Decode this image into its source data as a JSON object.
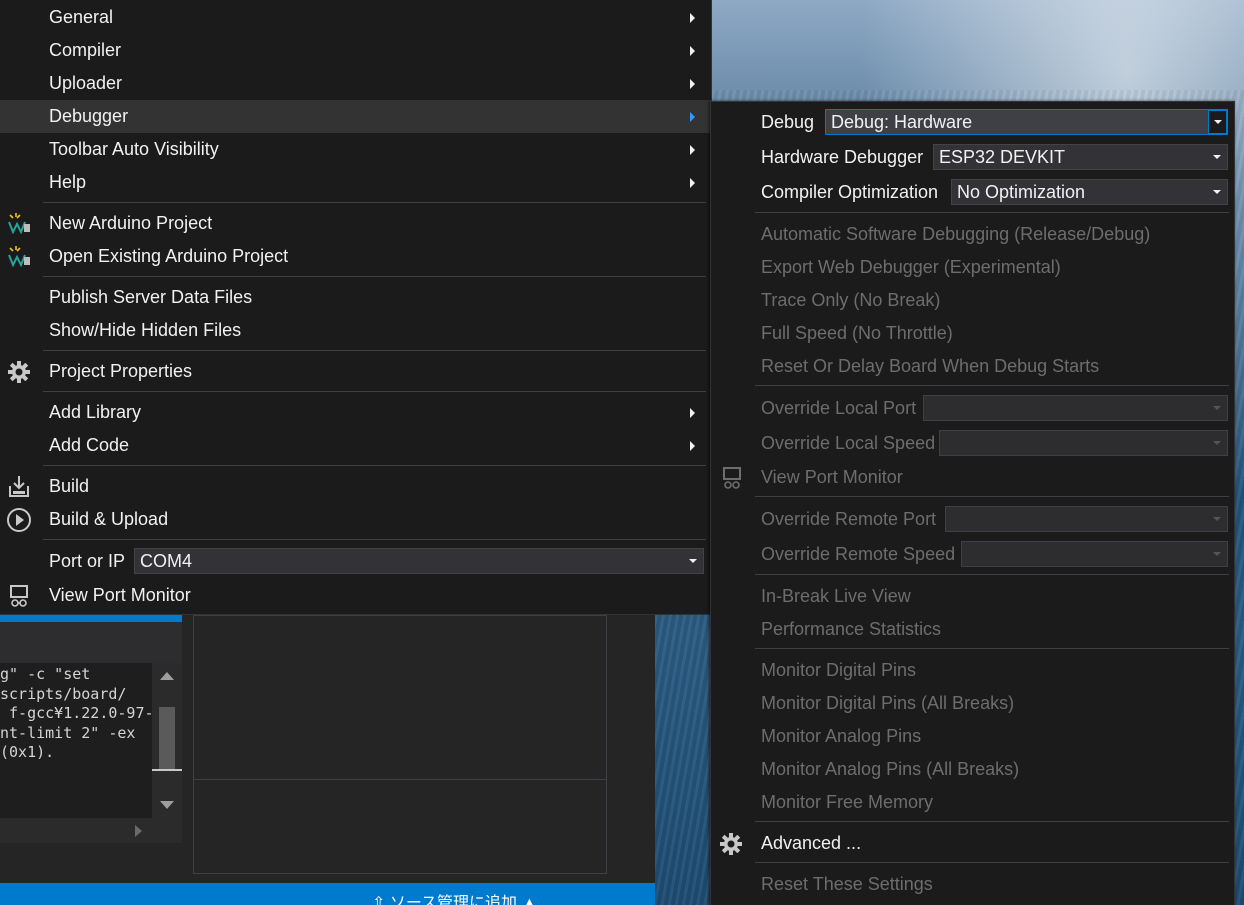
{
  "main_menu": {
    "items": [
      {
        "label": "General"
      },
      {
        "label": "Compiler"
      },
      {
        "label": "Uploader"
      },
      {
        "label": "Debugger"
      },
      {
        "label": "Toolbar Auto Visibility"
      },
      {
        "label": "Help"
      },
      {
        "label": "New Arduino Project"
      },
      {
        "label": "Open Existing Arduino Project"
      },
      {
        "label": "Publish Server Data Files"
      },
      {
        "label": "Show/Hide Hidden Files"
      },
      {
        "label": "Project Properties"
      },
      {
        "label": "Add Library"
      },
      {
        "label": "Add Code"
      },
      {
        "label": "Build"
      },
      {
        "label": "Build & Upload"
      },
      {
        "label": "Port or IP"
      },
      {
        "label": "View Port Monitor"
      }
    ],
    "port_value": "COM4"
  },
  "debugger_menu": {
    "debug_label": "Debug",
    "debug_value": "Debug: Hardware",
    "hw_debugger_label": "Hardware Debugger",
    "hw_debugger_value": "ESP32 DEVKIT",
    "compiler_opt_label": "Compiler Optimization",
    "compiler_opt_value": "No Optimization",
    "items": [
      {
        "label": "Automatic Software Debugging (Release/Debug)"
      },
      {
        "label": "Export Web Debugger (Experimental)"
      },
      {
        "label": "Trace Only (No Break)"
      },
      {
        "label": "Full Speed (No Throttle)"
      },
      {
        "label": "Reset Or Delay Board When Debug Starts"
      },
      {
        "label": "Override Local Port"
      },
      {
        "label": "Override Local Speed"
      },
      {
        "label": "View Port Monitor"
      },
      {
        "label": "Override Remote Port"
      },
      {
        "label": "Override Remote Speed"
      },
      {
        "label": "In-Break Live View"
      },
      {
        "label": "Performance Statistics"
      },
      {
        "label": "Monitor Digital Pins"
      },
      {
        "label": "Monitor Digital Pins (All Breaks)"
      },
      {
        "label": "Monitor Analog Pins"
      },
      {
        "label": "Monitor Analog Pins (All Breaks)"
      },
      {
        "label": "Monitor Free Memory"
      },
      {
        "label": "Advanced ..."
      },
      {
        "label": "Reset These Settings"
      }
    ]
  },
  "terminal_lines": [
    "g\" -c \"set",
    "scripts/board/",
    "",
    " f-gcc¥1.22.0-97-",
    "nt-limit 2\" -ex",
    "",
    "(0x1)."
  ],
  "statusbar": {
    "source_control": "⇧ ソース管理に追加 ▲"
  },
  "colors": {
    "menu_bg": "#1b1b1c",
    "highlight": "#333334",
    "accent": "#007acc",
    "disabled_text": "#6d6d6d"
  },
  "icons": [
    "arduino-project-icon",
    "gear-icon",
    "build-icon",
    "play-circle-icon",
    "port-monitor-icon"
  ]
}
